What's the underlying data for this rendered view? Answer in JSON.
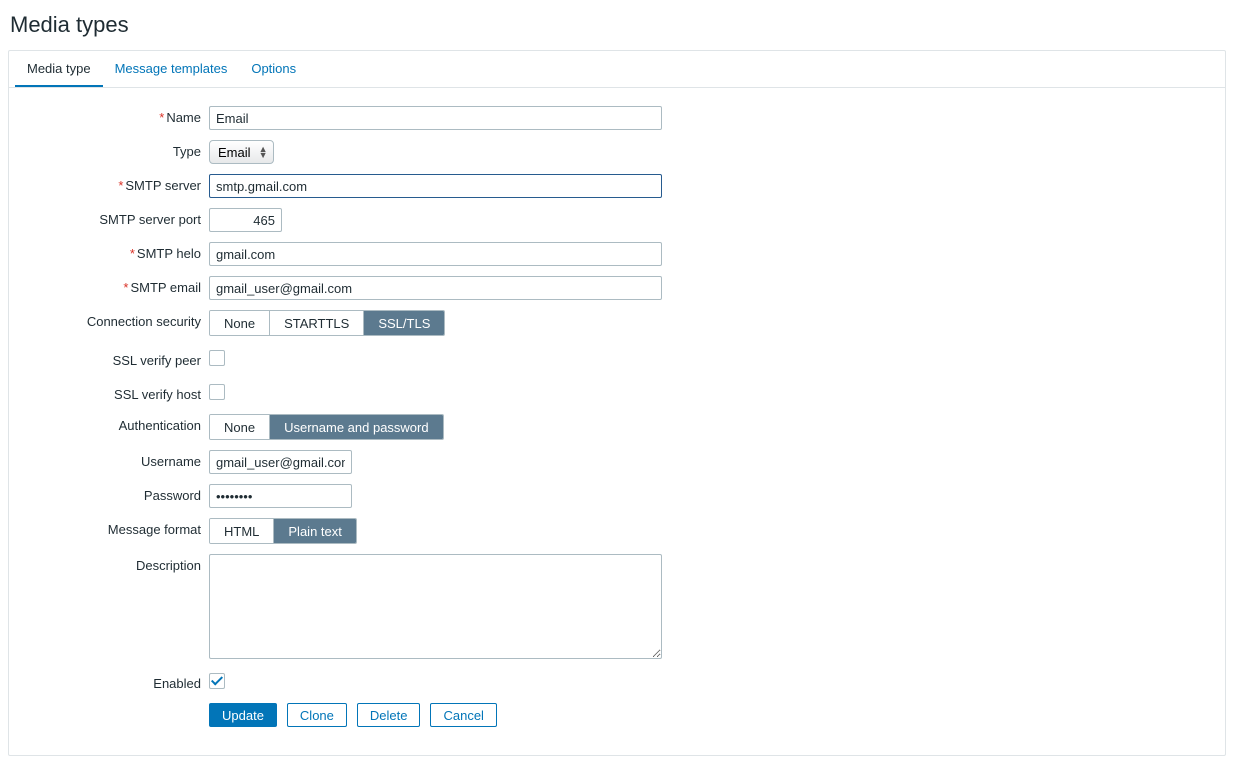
{
  "page": {
    "title": "Media types"
  },
  "tabs": {
    "media_type": "Media type",
    "message_templates": "Message templates",
    "options": "Options"
  },
  "labels": {
    "name": "Name",
    "type": "Type",
    "smtp_server": "SMTP server",
    "smtp_port": "SMTP server port",
    "smtp_helo": "SMTP helo",
    "smtp_email": "SMTP email",
    "conn_security": "Connection security",
    "ssl_verify_peer": "SSL verify peer",
    "ssl_verify_host": "SSL verify host",
    "authentication": "Authentication",
    "username": "Username",
    "password": "Password",
    "message_format": "Message format",
    "description": "Description",
    "enabled": "Enabled"
  },
  "values": {
    "name": "Email",
    "type": "Email",
    "smtp_server": "smtp.gmail.com",
    "smtp_port": "465",
    "smtp_helo": "gmail.com",
    "smtp_email": "gmail_user@gmail.com",
    "username": "gmail_user@gmail.com",
    "password": "••••••••",
    "description": ""
  },
  "segments": {
    "conn_security": {
      "none": "None",
      "starttls": "STARTTLS",
      "ssltls": "SSL/TLS"
    },
    "authentication": {
      "none": "None",
      "userpass": "Username and password"
    },
    "message_format": {
      "html": "HTML",
      "plain": "Plain text"
    }
  },
  "buttons": {
    "update": "Update",
    "clone": "Clone",
    "delete": "Delete",
    "cancel": "Cancel"
  }
}
